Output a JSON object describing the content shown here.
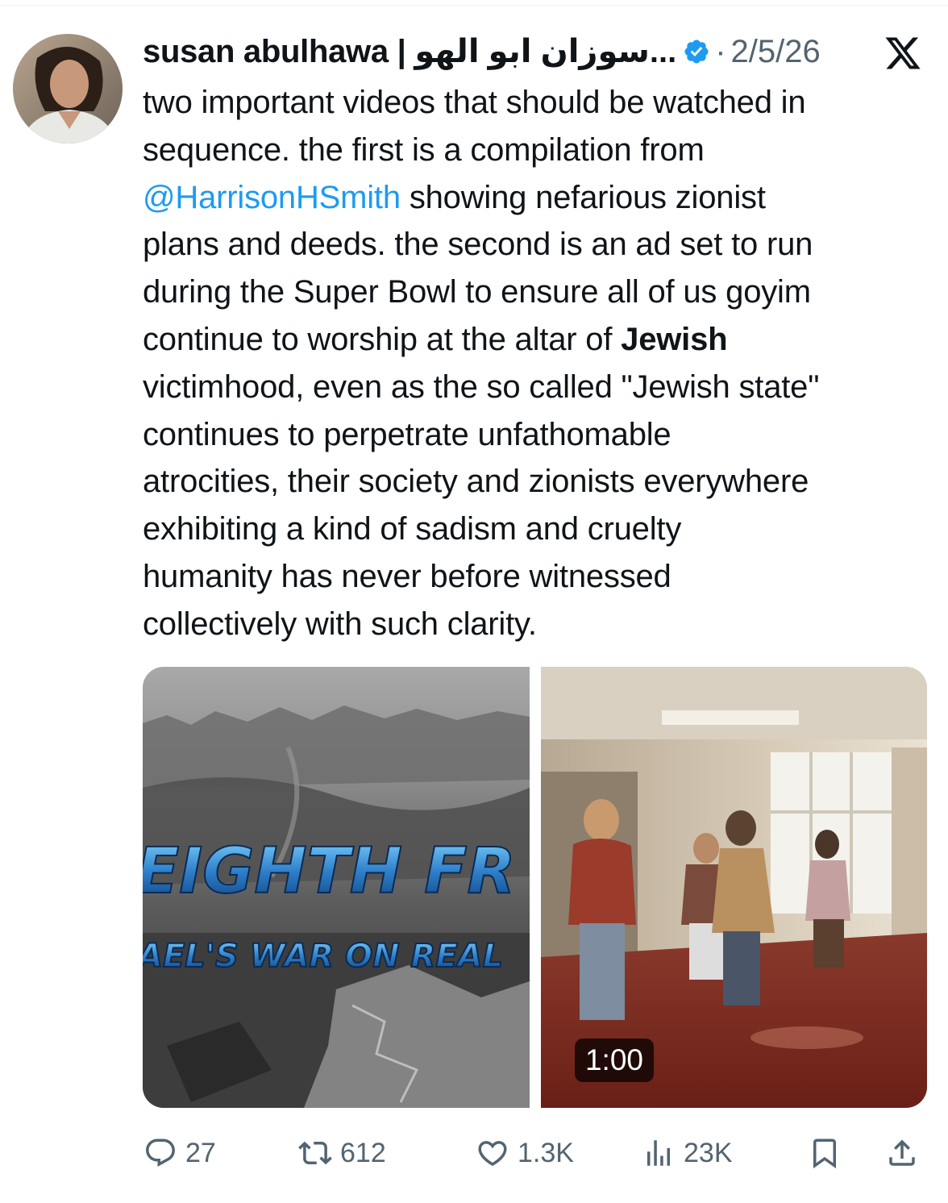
{
  "author": {
    "display_name": "susan abulhawa | سوزان ابو الهو...",
    "verified": true,
    "date": "2/5/26",
    "separator": "·"
  },
  "tweet": {
    "lines": [
      [
        "two important videos that should be watched in"
      ],
      [
        "sequence. the first is a compilation from"
      ],
      [
        "@HarrisonHSmith",
        " showing nefarious zionist"
      ],
      [
        "plans and deeds.  the second is an ad set to run"
      ],
      [
        "during the Super Bowl to ensure all of us goyim"
      ],
      [
        "continue to worship at the altar of ",
        "Jewish"
      ],
      [
        "victimhood, even as the so called \"Jewish state\""
      ],
      [
        "continues to perpetrate unfathomable"
      ],
      [
        "atrocities, their society and zionists everywhere"
      ],
      [
        "exhibiting a kind of sadism and cruelty"
      ],
      [
        "humanity has never before witnessed"
      ],
      [
        "collectively with such clarity."
      ]
    ]
  },
  "media": {
    "left_overlay_title": "EIGHTH FR",
    "left_overlay_subtitle": "AEL'S WAR ON REAL",
    "video_duration": "1:00"
  },
  "actions": {
    "replies": "27",
    "reposts": "612",
    "likes": "1.3K",
    "views": "23K"
  },
  "colors": {
    "link": "#1d9bf0",
    "verified": "#1d9bf0",
    "muted": "#536471"
  },
  "icons": [
    "verified-badge-icon",
    "x-logo-icon",
    "reply-icon",
    "repost-icon",
    "like-icon",
    "views-icon",
    "bookmark-icon",
    "share-icon"
  ]
}
